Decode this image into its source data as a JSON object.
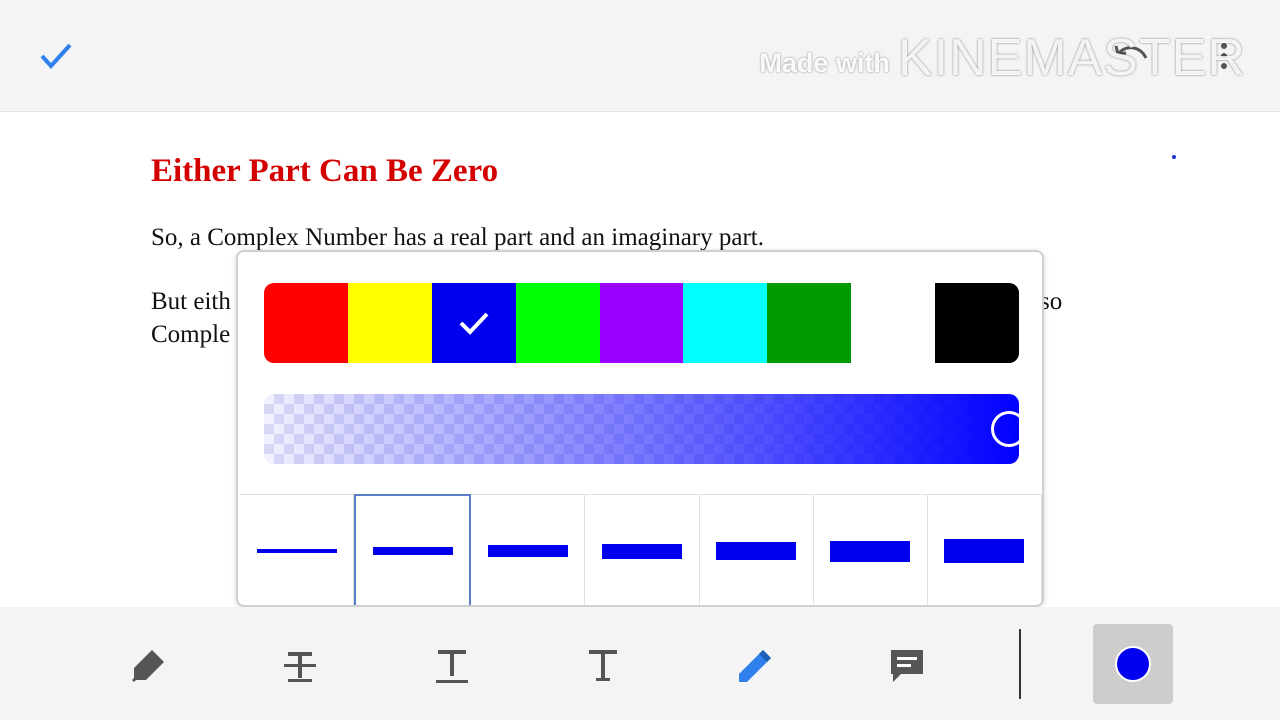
{
  "watermark": {
    "small": "Made with",
    "big": "KINEMASTER"
  },
  "document": {
    "title": "Either Part Can Be Zero",
    "para1": "So, a Complex Number has a real part and an imaginary part.",
    "para2_line1": "But eith",
    "para2_line2": "Comple",
    "para2_tail": "so"
  },
  "picker": {
    "swatches": [
      "#ff0000",
      "#ffff00",
      "#0000ee",
      "#00ff00",
      "#9900ff",
      "#00ffff",
      "#009900",
      "#ffffff",
      "#000000"
    ],
    "selected_swatch": 2,
    "opacity_percent": 100,
    "widths_selected": 1
  },
  "colors": {
    "accent_blue": "#2f80ed",
    "pen_blue": "#0000ee",
    "title_red": "#d40000"
  },
  "toolbar": {
    "tools": [
      "highlighter-icon",
      "strikethrough-icon",
      "underline-icon",
      "text-icon",
      "pen-icon",
      "comment-icon"
    ],
    "active_tool": "pen-icon"
  }
}
